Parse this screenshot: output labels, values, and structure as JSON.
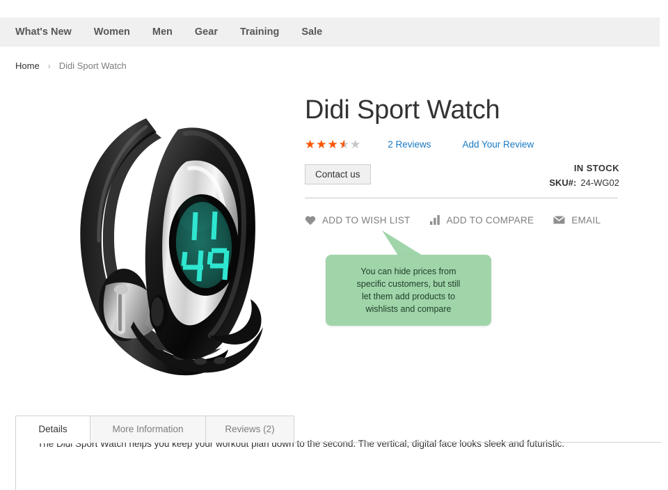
{
  "nav": {
    "items": [
      {
        "label": "What's New"
      },
      {
        "label": "Women"
      },
      {
        "label": "Men"
      },
      {
        "label": "Gear"
      },
      {
        "label": "Training"
      },
      {
        "label": "Sale"
      }
    ]
  },
  "breadcrumb": {
    "home": "Home",
    "separator": "›",
    "current": "Didi Sport Watch"
  },
  "product": {
    "title": "Didi Sport Watch",
    "rating_stars": "★★★★★",
    "rating_percent": 70,
    "reviews_link": "2 Reviews",
    "add_review_link": "Add Your Review",
    "contact_button": "Contact us",
    "stock_status": "IN STOCK",
    "sku_label": "SKU#:",
    "sku_value": "24-WG02",
    "image_alt": "didi-sport-watch-black-band-silver-case-digital-display",
    "display_top": "11",
    "display_bottom": "49"
  },
  "actions": [
    {
      "icon": "heart-icon",
      "label": "ADD TO WISH LIST"
    },
    {
      "icon": "bar-chart-icon",
      "label": "ADD TO COMPARE"
    },
    {
      "icon": "envelope-icon",
      "label": "EMAIL"
    }
  ],
  "callout": {
    "text": "You can hide prices from\nspecific customers, but still\nlet them add products to\nwishlists and compare",
    "background_color": "#a0d5aa",
    "text_color": "#1e3d28"
  },
  "tabs": [
    {
      "label": "Details",
      "active": true
    },
    {
      "label": "More Information",
      "active": false
    },
    {
      "label": "Reviews (2)",
      "active": false
    }
  ],
  "details": {
    "description": "The Didi Sport Watch helps you keep your workout plan down to the second. The vertical, digital face looks sleek and futuristic."
  },
  "colors": {
    "nav_background": "#f0f0f0",
    "star_filled": "#ff5501",
    "star_empty": "#c7c7c7",
    "link_blue": "#1979c3",
    "muted_text": "#7d7d7d"
  }
}
